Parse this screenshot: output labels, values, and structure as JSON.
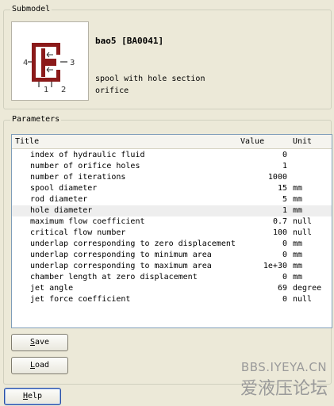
{
  "submodel": {
    "legend": "Submodel",
    "name": "bao5 [BA0041]",
    "description": [
      "spool with hole section",
      "orifice"
    ],
    "port_labels": [
      "4",
      "3",
      "1",
      "2"
    ]
  },
  "parameters": {
    "legend": "Parameters",
    "columns": {
      "title": "Title",
      "value": "Value",
      "unit": "Unit"
    },
    "rows": [
      {
        "title": "index of hydraulic fluid",
        "value": "0",
        "unit": ""
      },
      {
        "title": "number of orifice holes",
        "value": "1",
        "unit": ""
      },
      {
        "title": "number of iterations",
        "value": "1000",
        "unit": ""
      },
      {
        "title": "spool diameter",
        "value": "15",
        "unit": "mm"
      },
      {
        "title": "rod diameter",
        "value": "5",
        "unit": "mm"
      },
      {
        "title": "hole diameter",
        "value": "1",
        "unit": "mm",
        "selected": true
      },
      {
        "title": "maximum flow coefficient",
        "value": "0.7",
        "unit": "null"
      },
      {
        "title": "critical flow number",
        "value": "100",
        "unit": "null"
      },
      {
        "title": "underlap corresponding to zero displacement",
        "value": "0",
        "unit": "mm"
      },
      {
        "title": "underlap corresponding to minimum area",
        "value": "0",
        "unit": "mm"
      },
      {
        "title": "underlap corresponding to maximum area",
        "value": "1e+30",
        "unit": "mm"
      },
      {
        "title": "chamber length at zero displacement",
        "value": "0",
        "unit": "mm"
      },
      {
        "title": "jet angle",
        "value": "69",
        "unit": "degree"
      },
      {
        "title": "jet force coefficient",
        "value": "0",
        "unit": "null"
      }
    ]
  },
  "buttons": {
    "save_label": [
      "S",
      "ave"
    ],
    "load_label": [
      "L",
      "oad"
    ],
    "help_label": [
      "H",
      "elp"
    ]
  },
  "watermark": {
    "line1": "BBS.IYEYA.CN",
    "line2": "爱液压论坛"
  },
  "colors": {
    "symbol": "#8b1a1a",
    "arrow": "#555555"
  }
}
